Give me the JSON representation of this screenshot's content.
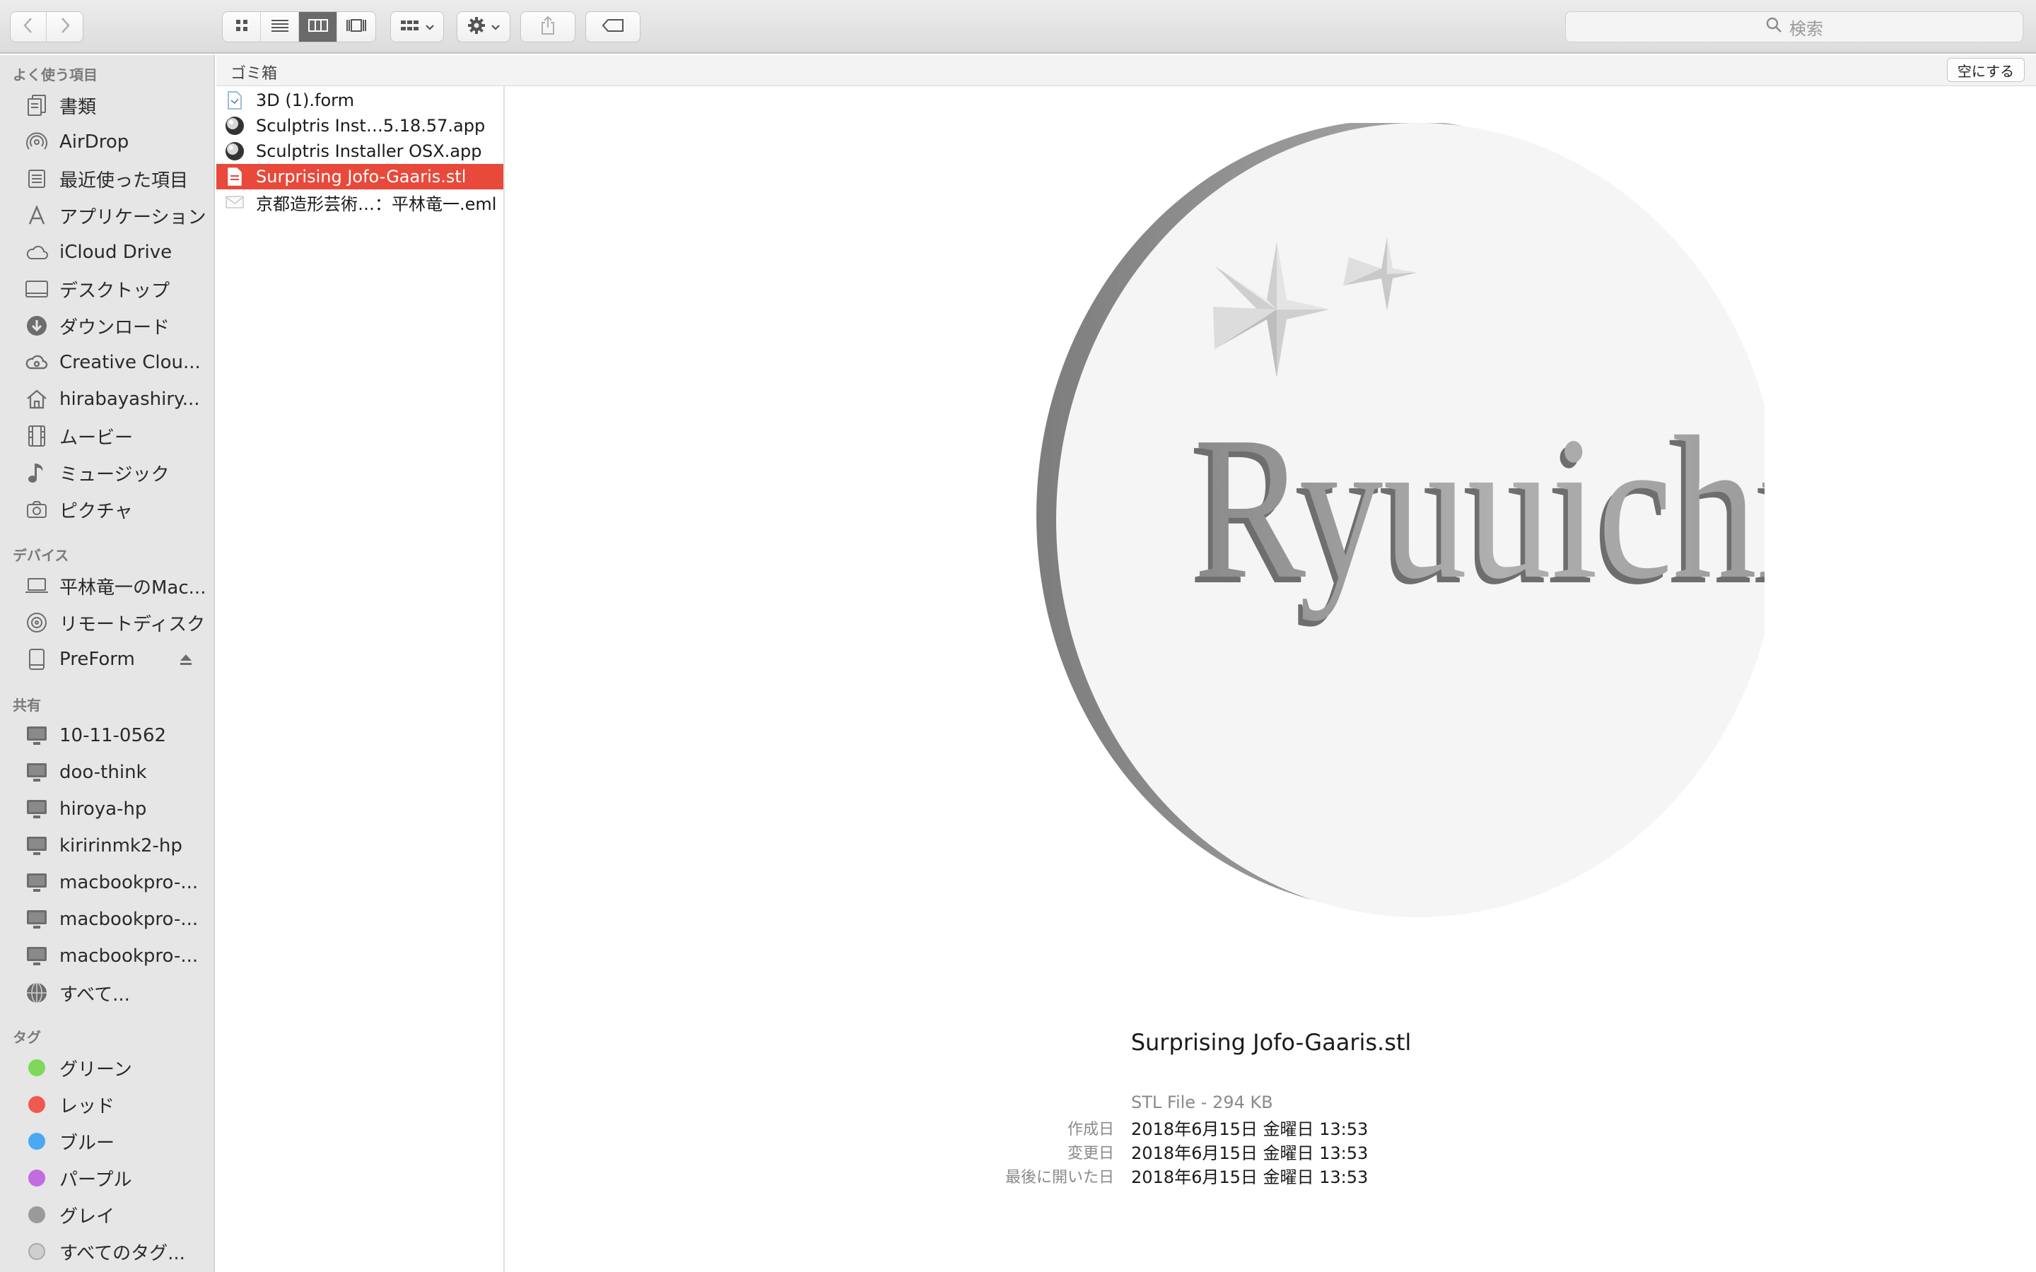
{
  "toolbar": {
    "search_placeholder": "検索"
  },
  "sidebar": {
    "favorites_header": "よく使う項目",
    "favorites": [
      {
        "label": "書類",
        "icon": "documents-icon"
      },
      {
        "label": "AirDrop",
        "icon": "airdrop-icon"
      },
      {
        "label": "最近使った項目",
        "icon": "recents-icon"
      },
      {
        "label": "アプリケーション",
        "icon": "applications-icon"
      },
      {
        "label": "iCloud Drive",
        "icon": "cloud-icon"
      },
      {
        "label": "デスクトップ",
        "icon": "desktop-icon"
      },
      {
        "label": "ダウンロード",
        "icon": "download-icon"
      },
      {
        "label": "Creative Clou...",
        "icon": "creative-cloud-icon"
      },
      {
        "label": "hirabayashiry...",
        "icon": "home-icon"
      },
      {
        "label": "ムービー",
        "icon": "movies-icon"
      },
      {
        "label": "ミュージック",
        "icon": "music-icon"
      },
      {
        "label": "ピクチャ",
        "icon": "camera-icon"
      }
    ],
    "devices_header": "デバイス",
    "devices": [
      {
        "label": "平林竜一のMac...",
        "icon": "laptop-icon"
      },
      {
        "label": "リモートディスク",
        "icon": "disc-icon"
      },
      {
        "label": "PreForm",
        "icon": "drive-icon"
      }
    ],
    "shared_header": "共有",
    "shared": [
      {
        "label": "10-11-0562",
        "icon": "monitor-icon"
      },
      {
        "label": "doo-think",
        "icon": "monitor-icon"
      },
      {
        "label": "hiroya-hp",
        "icon": "monitor-icon"
      },
      {
        "label": "kiririnmk2-hp",
        "icon": "monitor-icon"
      },
      {
        "label": "macbookpro-...",
        "icon": "monitor-icon"
      },
      {
        "label": "macbookpro-...",
        "icon": "monitor-icon"
      },
      {
        "label": "macbookpro-...",
        "icon": "monitor-icon"
      },
      {
        "label": "すべて...",
        "icon": "network-icon"
      }
    ],
    "tags_header": "タグ",
    "tags": [
      {
        "label": "グリーン",
        "color": "#7ed85a"
      },
      {
        "label": "レッド",
        "color": "#f0594e"
      },
      {
        "label": "ブルー",
        "color": "#4aa8f5"
      },
      {
        "label": "パープル",
        "color": "#c36ce0"
      },
      {
        "label": "グレイ",
        "color": "#9a9a9a"
      },
      {
        "label": "すべてのタグ...",
        "color": "#cfcfcf"
      }
    ]
  },
  "column": {
    "path_label": "ゴミ箱",
    "empty_button": "空にする",
    "files": [
      {
        "name": "3D (1).form",
        "icon": "form-file-icon",
        "selected": false
      },
      {
        "name": "Sculptris Inst…5.18.57.app",
        "icon": "sculptris-app-icon",
        "selected": false
      },
      {
        "name": "Sculptris Installer OSX.app",
        "icon": "sculptris-app-icon",
        "selected": false
      },
      {
        "name": "Surprising Jofo-Gaaris.stl",
        "icon": "stl-file-icon",
        "selected": true
      },
      {
        "name": "京都造形芸術…：平林竜一.eml",
        "icon": "mail-file-icon",
        "selected": false
      }
    ]
  },
  "preview": {
    "model_text": "Ryuuichi",
    "file_name": "Surprising Jofo-Gaaris.stl",
    "kind_size": "STL File - 294 KB",
    "meta": [
      {
        "key": "作成日",
        "value": "2018年6月15日 金曜日 13:53"
      },
      {
        "key": "変更日",
        "value": "2018年6月15日 金曜日 13:53"
      },
      {
        "key": "最後に開いた日",
        "value": "2018年6月15日 金曜日 13:53"
      }
    ]
  }
}
